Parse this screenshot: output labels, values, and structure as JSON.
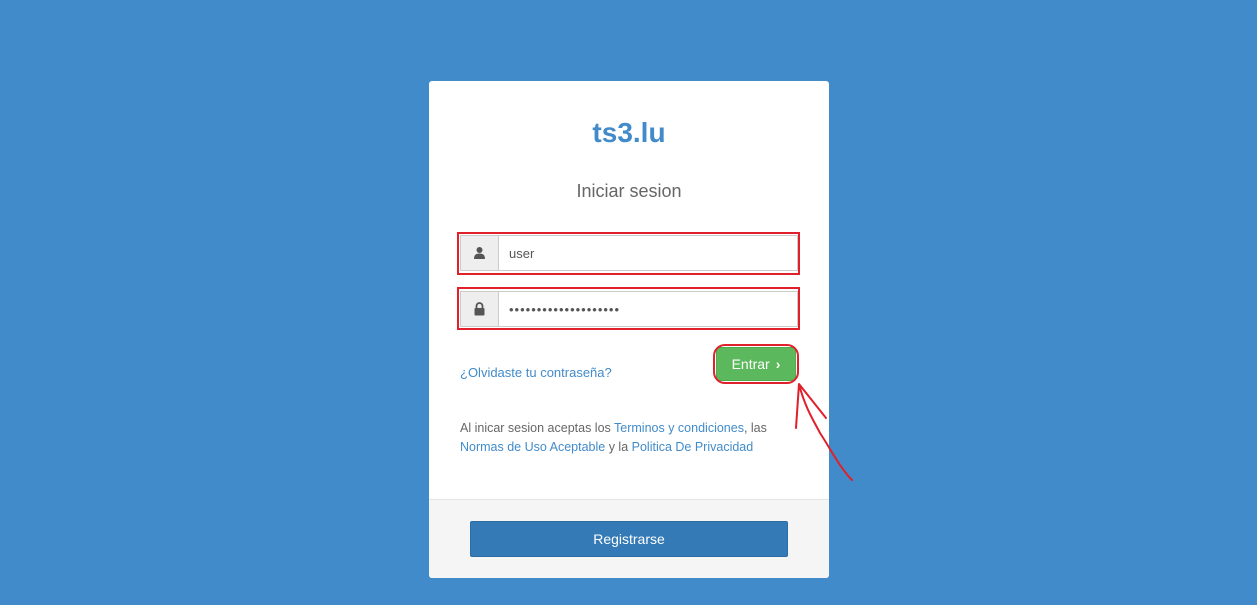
{
  "brand": "ts3.lu",
  "subtitle": "Iniciar sesion",
  "login": {
    "username_value": "user",
    "password_value": "••••••••••••••••••••",
    "submit_label": "Entrar",
    "submit_chevron": "›"
  },
  "forgot_link": "¿Olvidaste tu contraseña?",
  "terms": {
    "prefix": "Al inicar sesion aceptas los ",
    "link_terms": "Terminos y condiciones",
    "sep1": ", las ",
    "link_norms": "Normas de Uso Aceptable",
    "sep2": " y la ",
    "link_privacy": "Politica De Privacidad"
  },
  "register_label": "Registrarse",
  "icons": {
    "username": "user-icon",
    "password": "lock-icon"
  },
  "colors": {
    "background": "#428bca",
    "brand": "#428bca",
    "submit": "#5cb85c",
    "register": "#337ab7",
    "annotation": "#e0202a"
  }
}
